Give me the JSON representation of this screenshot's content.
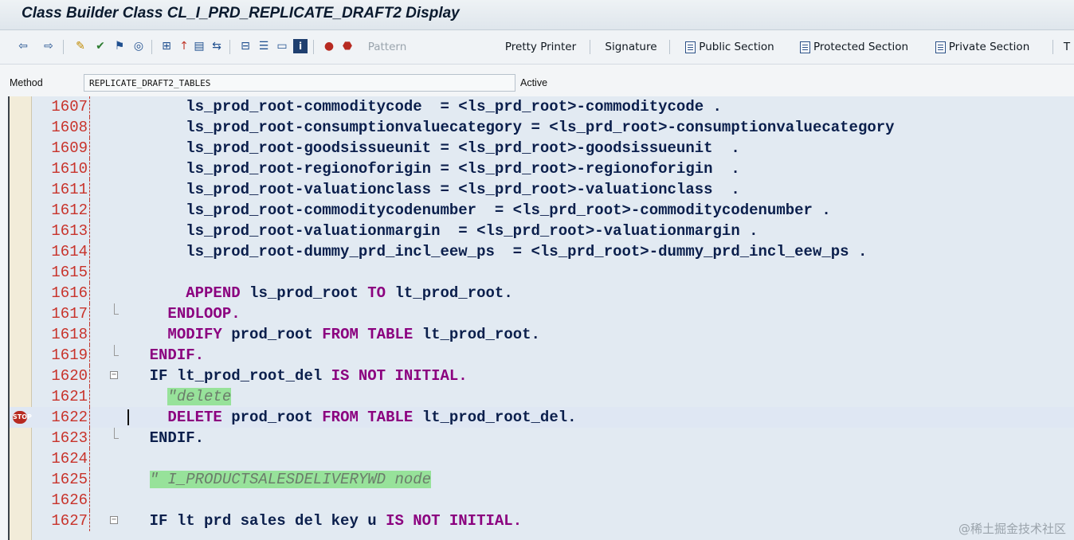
{
  "window": {
    "title": "Class Builder Class CL_I_PRD_REPLICATE_DRAFT2 Display"
  },
  "toolbar": {
    "pattern": "Pattern",
    "pretty_printer": "Pretty Printer",
    "signature": "Signature",
    "public_section": "Public Section",
    "protected_section": "Protected Section",
    "private_section": "Private Section",
    "truncated": "T"
  },
  "method_bar": {
    "label": "Method",
    "value": "REPLICATE_DRAFT2_TABLES",
    "status": "Active"
  },
  "editor": {
    "lines": [
      {
        "no": "1607",
        "parts": [
          {
            "t": "        ls_prod_root-commoditycode  = <ls_prd_root>-commoditycode ."
          }
        ]
      },
      {
        "no": "1608",
        "parts": [
          {
            "t": "        ls_prod_root-consumptionvaluecategory = <ls_prd_root>-consumptionvaluecategory"
          }
        ]
      },
      {
        "no": "1609",
        "parts": [
          {
            "t": "        ls_prod_root-goodsissueunit = <ls_prd_root>-goodsissueunit  ."
          }
        ]
      },
      {
        "no": "1610",
        "parts": [
          {
            "t": "        ls_prod_root-regionoforigin = <ls_prd_root>-regionoforigin  ."
          }
        ]
      },
      {
        "no": "1611",
        "parts": [
          {
            "t": "        ls_prod_root-valuationclass = <ls_prd_root>-valuationclass  ."
          }
        ]
      },
      {
        "no": "1612",
        "parts": [
          {
            "t": "        ls_prod_root-commoditycodenumber  = <ls_prd_root>-commoditycodenumber ."
          }
        ]
      },
      {
        "no": "1613",
        "parts": [
          {
            "t": "        ls_prod_root-valuationmargin  = <ls_prd_root>-valuationmargin ."
          }
        ]
      },
      {
        "no": "1614",
        "parts": [
          {
            "t": "        ls_prod_root-dummy_prd_incl_eew_ps  = <ls_prd_root>-dummy_prd_incl_eew_ps ."
          }
        ]
      },
      {
        "no": "1615",
        "parts": []
      },
      {
        "no": "1616",
        "parts": [
          {
            "t": "        "
          },
          {
            "t": "APPEND",
            "c": "kw"
          },
          {
            "t": " ls_prod_root "
          },
          {
            "t": "TO",
            "c": "kw"
          },
          {
            "t": " lt_prod_root."
          }
        ]
      },
      {
        "no": "1617",
        "parts": [
          {
            "t": "      "
          },
          {
            "t": "ENDLOOP.",
            "c": "kw"
          }
        ]
      },
      {
        "no": "1618",
        "parts": [
          {
            "t": "      "
          },
          {
            "t": "MODIFY",
            "c": "kw"
          },
          {
            "t": " prod_root "
          },
          {
            "t": "FROM TABLE",
            "c": "kw"
          },
          {
            "t": " lt_prod_root."
          }
        ]
      },
      {
        "no": "1619",
        "parts": [
          {
            "t": "    "
          },
          {
            "t": "ENDIF.",
            "c": "kw"
          }
        ]
      },
      {
        "no": "1620",
        "parts": [
          {
            "t": "    IF lt_prod_root_del "
          },
          {
            "t": "IS NOT INITIAL.",
            "c": "kw"
          }
        ]
      },
      {
        "no": "1621",
        "parts": [
          {
            "t": "      "
          },
          {
            "t": "\"delete",
            "c": "cm"
          }
        ]
      },
      {
        "no": "1622",
        "parts": [
          {
            "t": "      "
          },
          {
            "t": "DELETE",
            "c": "kw"
          },
          {
            "t": " prod_root "
          },
          {
            "t": "FROM TABLE",
            "c": "kw"
          },
          {
            "t": " lt_prod_root_del."
          }
        ]
      },
      {
        "no": "1623",
        "parts": [
          {
            "t": "    ENDIF."
          }
        ]
      },
      {
        "no": "1624",
        "parts": []
      },
      {
        "no": "1625",
        "parts": [
          {
            "t": "    "
          },
          {
            "t": "\" I_PRODUCTSALESDELIVERYWD node",
            "c": "cm"
          }
        ]
      },
      {
        "no": "1626",
        "parts": []
      },
      {
        "no": "1627",
        "parts": [
          {
            "t": "    IF lt prd sales del key u "
          },
          {
            "t": "IS NOT INITIAL.",
            "c": "kw"
          }
        ]
      }
    ],
    "breakpoint_label": "STOP"
  },
  "watermark": "@稀土掘金技术社区"
}
